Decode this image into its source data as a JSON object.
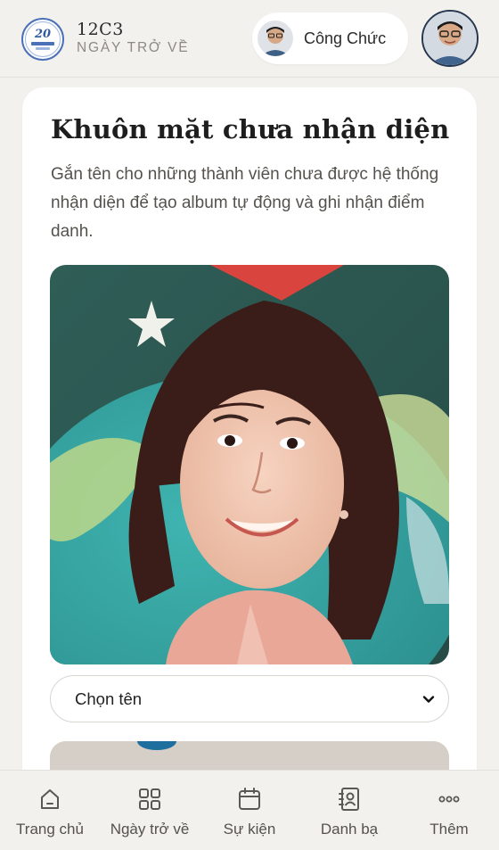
{
  "header": {
    "brand_title": "12C3",
    "brand_subtitle": "NGÀY TRỞ VỀ",
    "user_name": "Công Chức",
    "logo_number": "20"
  },
  "card": {
    "title": "Khuôn mặt chưa nhận diện",
    "description": "Gắn tên cho những thành viên chưa được hệ thống nhận diện để tạo album tự động và ghi nhận điểm danh.",
    "select": {
      "selected": "Chọn tên"
    }
  },
  "nav": {
    "items": [
      {
        "label": "Trang chủ",
        "icon": "home-icon"
      },
      {
        "label": "Ngày trở về",
        "icon": "grid-icon"
      },
      {
        "label": "Sự kiện",
        "icon": "calendar-icon"
      },
      {
        "label": "Danh bạ",
        "icon": "contacts-icon"
      },
      {
        "label": "Thêm",
        "icon": "more-icon"
      }
    ]
  },
  "colors": {
    "background": "#f2f1ee",
    "card": "#ffffff",
    "text_primary": "#1e1e1e",
    "text_muted": "#8d8a84",
    "logo_blue": "#4a72b8"
  }
}
